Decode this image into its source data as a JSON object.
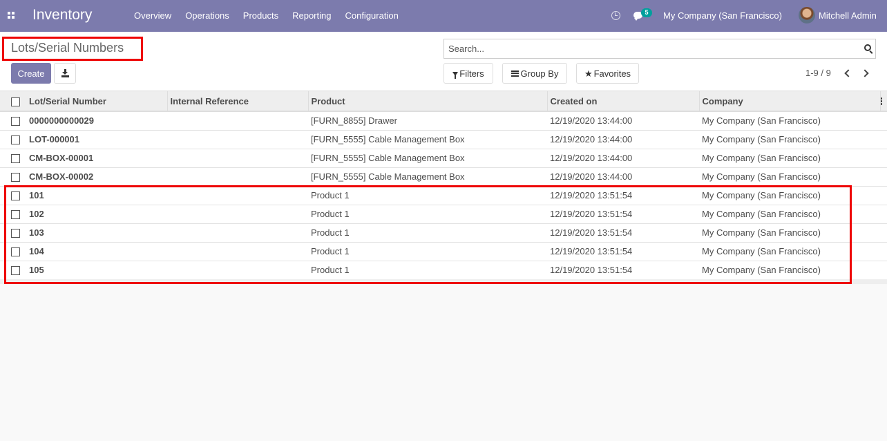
{
  "navbar": {
    "app_name": "Inventory",
    "menu": [
      "Overview",
      "Operations",
      "Products",
      "Reporting",
      "Configuration"
    ],
    "chat_count": "5",
    "company": "My Company (San Francisco)",
    "user": "Mitchell Admin"
  },
  "control_panel": {
    "breadcrumb": "Lots/Serial Numbers",
    "create_label": "Create",
    "search_placeholder": "Search...",
    "filters_label": "Filters",
    "group_by_label": "Group By",
    "favorites_label": "Favorites",
    "pager": "1-9 / 9"
  },
  "table": {
    "columns": [
      "Lot/Serial Number",
      "Internal Reference",
      "Product",
      "Created on",
      "Company"
    ],
    "rows": [
      {
        "name": "0000000000029",
        "ref": "",
        "product": "[FURN_8855] Drawer",
        "created": "12/19/2020 13:44:00",
        "company": "My Company (San Francisco)"
      },
      {
        "name": "LOT-000001",
        "ref": "",
        "product": "[FURN_5555] Cable Management Box",
        "created": "12/19/2020 13:44:00",
        "company": "My Company (San Francisco)"
      },
      {
        "name": "CM-BOX-00001",
        "ref": "",
        "product": "[FURN_5555] Cable Management Box",
        "created": "12/19/2020 13:44:00",
        "company": "My Company (San Francisco)"
      },
      {
        "name": "CM-BOX-00002",
        "ref": "",
        "product": "[FURN_5555] Cable Management Box",
        "created": "12/19/2020 13:44:00",
        "company": "My Company (San Francisco)"
      },
      {
        "name": "101",
        "ref": "",
        "product": "Product 1",
        "created": "12/19/2020 13:51:54",
        "company": "My Company (San Francisco)"
      },
      {
        "name": "102",
        "ref": "",
        "product": "Product 1",
        "created": "12/19/2020 13:51:54",
        "company": "My Company (San Francisco)"
      },
      {
        "name": "103",
        "ref": "",
        "product": "Product 1",
        "created": "12/19/2020 13:51:54",
        "company": "My Company (San Francisco)"
      },
      {
        "name": "104",
        "ref": "",
        "product": "Product 1",
        "created": "12/19/2020 13:51:54",
        "company": "My Company (San Francisco)"
      },
      {
        "name": "105",
        "ref": "",
        "product": "Product 1",
        "created": "12/19/2020 13:51:54",
        "company": "My Company (San Francisco)"
      }
    ]
  },
  "colors": {
    "brand": "#7c7bad",
    "badge": "#00a09d",
    "highlight": "#e00000"
  }
}
